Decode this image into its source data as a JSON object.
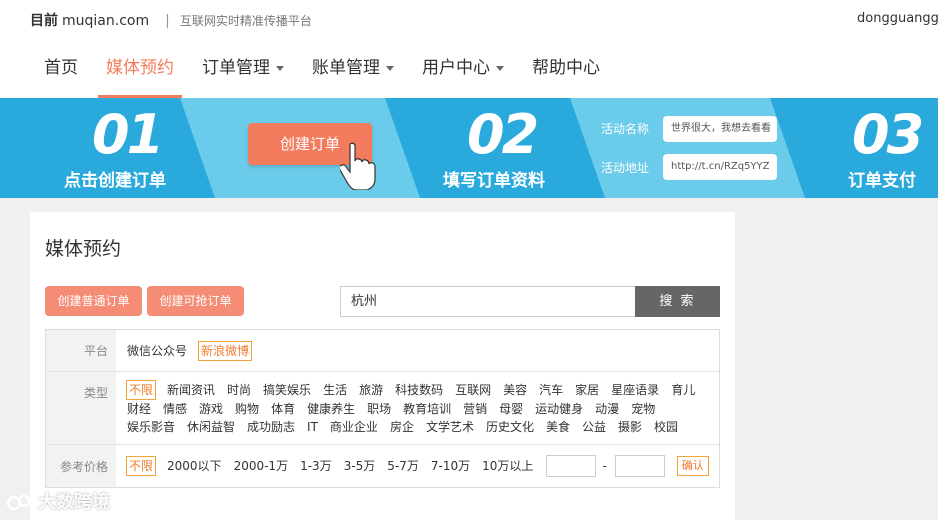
{
  "header": {
    "brand_bold": "目前",
    "brand_domain": "muqian.com",
    "separator": "|",
    "slogan": "互联网实时精准传播平台",
    "username": "dongguanggang"
  },
  "nav": {
    "items": [
      {
        "label": "首页"
      },
      {
        "label": "媒体预约"
      },
      {
        "label": "订单管理"
      },
      {
        "label": "账单管理"
      },
      {
        "label": "用户中心"
      },
      {
        "label": "帮助中心"
      }
    ]
  },
  "banner": {
    "step1_num": "01",
    "step1_label": "点击创建订单",
    "create_button": "创建订单",
    "step2_num": "02",
    "step2_label": "填写订单资料",
    "activity_name_label": "活动名称",
    "activity_name_value": "世界很大，我想去看看",
    "activity_url_label": "活动地址",
    "activity_url_value": "http://t.cn/RZq5YYZ",
    "step3_num": "03",
    "step3_label": "订单支付",
    "colors": {
      "dark": "#2aaadc",
      "light": "#6bcbea",
      "accent": "#f47c5e"
    }
  },
  "panel": {
    "title": "媒体预约",
    "btn_normal_order": "创建普通订单",
    "btn_grab_order": "创建可抢订单",
    "search_value": "杭州",
    "search_button": "搜 索"
  },
  "filters": {
    "platform_label": "平台",
    "platforms": [
      "微信公众号",
      "新浪微博"
    ],
    "type_label": "类型",
    "types": [
      "不限",
      "新闻资讯",
      "时尚",
      "搞笑娱乐",
      "生活",
      "旅游",
      "科技数码",
      "互联网",
      "美容",
      "汽车",
      "家居",
      "星座语录",
      "育儿",
      "财经",
      "情感",
      "游戏",
      "购物",
      "体育",
      "健康养生",
      "职场",
      "教育培训",
      "营销",
      "母婴",
      "运动健身",
      "动漫",
      "宠物",
      "娱乐影音",
      "休闲益智",
      "成功励志",
      "IT",
      "商业企业",
      "房企",
      "文学艺术",
      "历史文化",
      "美食",
      "公益",
      "摄影",
      "校园"
    ],
    "price_label": "参考价格",
    "prices": [
      "不限",
      "2000以下",
      "2000-1万",
      "1-3万",
      "3-5万",
      "5-7万",
      "7-10万",
      "10万以上"
    ],
    "range_dash": "-",
    "confirm": "确认"
  },
  "watermark": "大数跨境"
}
